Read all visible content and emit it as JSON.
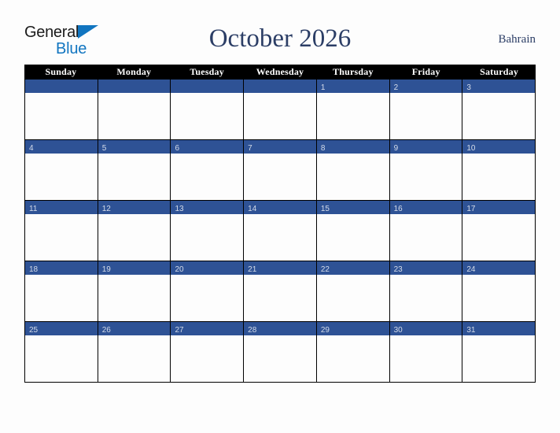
{
  "brand": {
    "word1": "General",
    "word2": "Blue",
    "triangle_color": "#1175c0",
    "word1_color": "#1b1b1b",
    "word2_color": "#1175c0"
  },
  "header": {
    "title": "October 2026",
    "country": "Bahrain",
    "title_color": "#2c3e66"
  },
  "calendar": {
    "weekday_headers": [
      "Sunday",
      "Monday",
      "Tuesday",
      "Wednesday",
      "Thursday",
      "Friday",
      "Saturday"
    ],
    "header_bg": "#000000",
    "header_text_color": "#ffffff",
    "day_band_color": "#2e5295",
    "day_number_color": "#d5dce9",
    "cell_bg": "#fdfdfd",
    "grid_line_color": "#000000",
    "weeks": [
      [
        "",
        "",
        "",
        "",
        "1",
        "2",
        "3"
      ],
      [
        "4",
        "5",
        "6",
        "7",
        "8",
        "9",
        "10"
      ],
      [
        "11",
        "12",
        "13",
        "14",
        "15",
        "16",
        "17"
      ],
      [
        "18",
        "19",
        "20",
        "21",
        "22",
        "23",
        "24"
      ],
      [
        "25",
        "26",
        "27",
        "28",
        "29",
        "30",
        "31"
      ]
    ]
  }
}
